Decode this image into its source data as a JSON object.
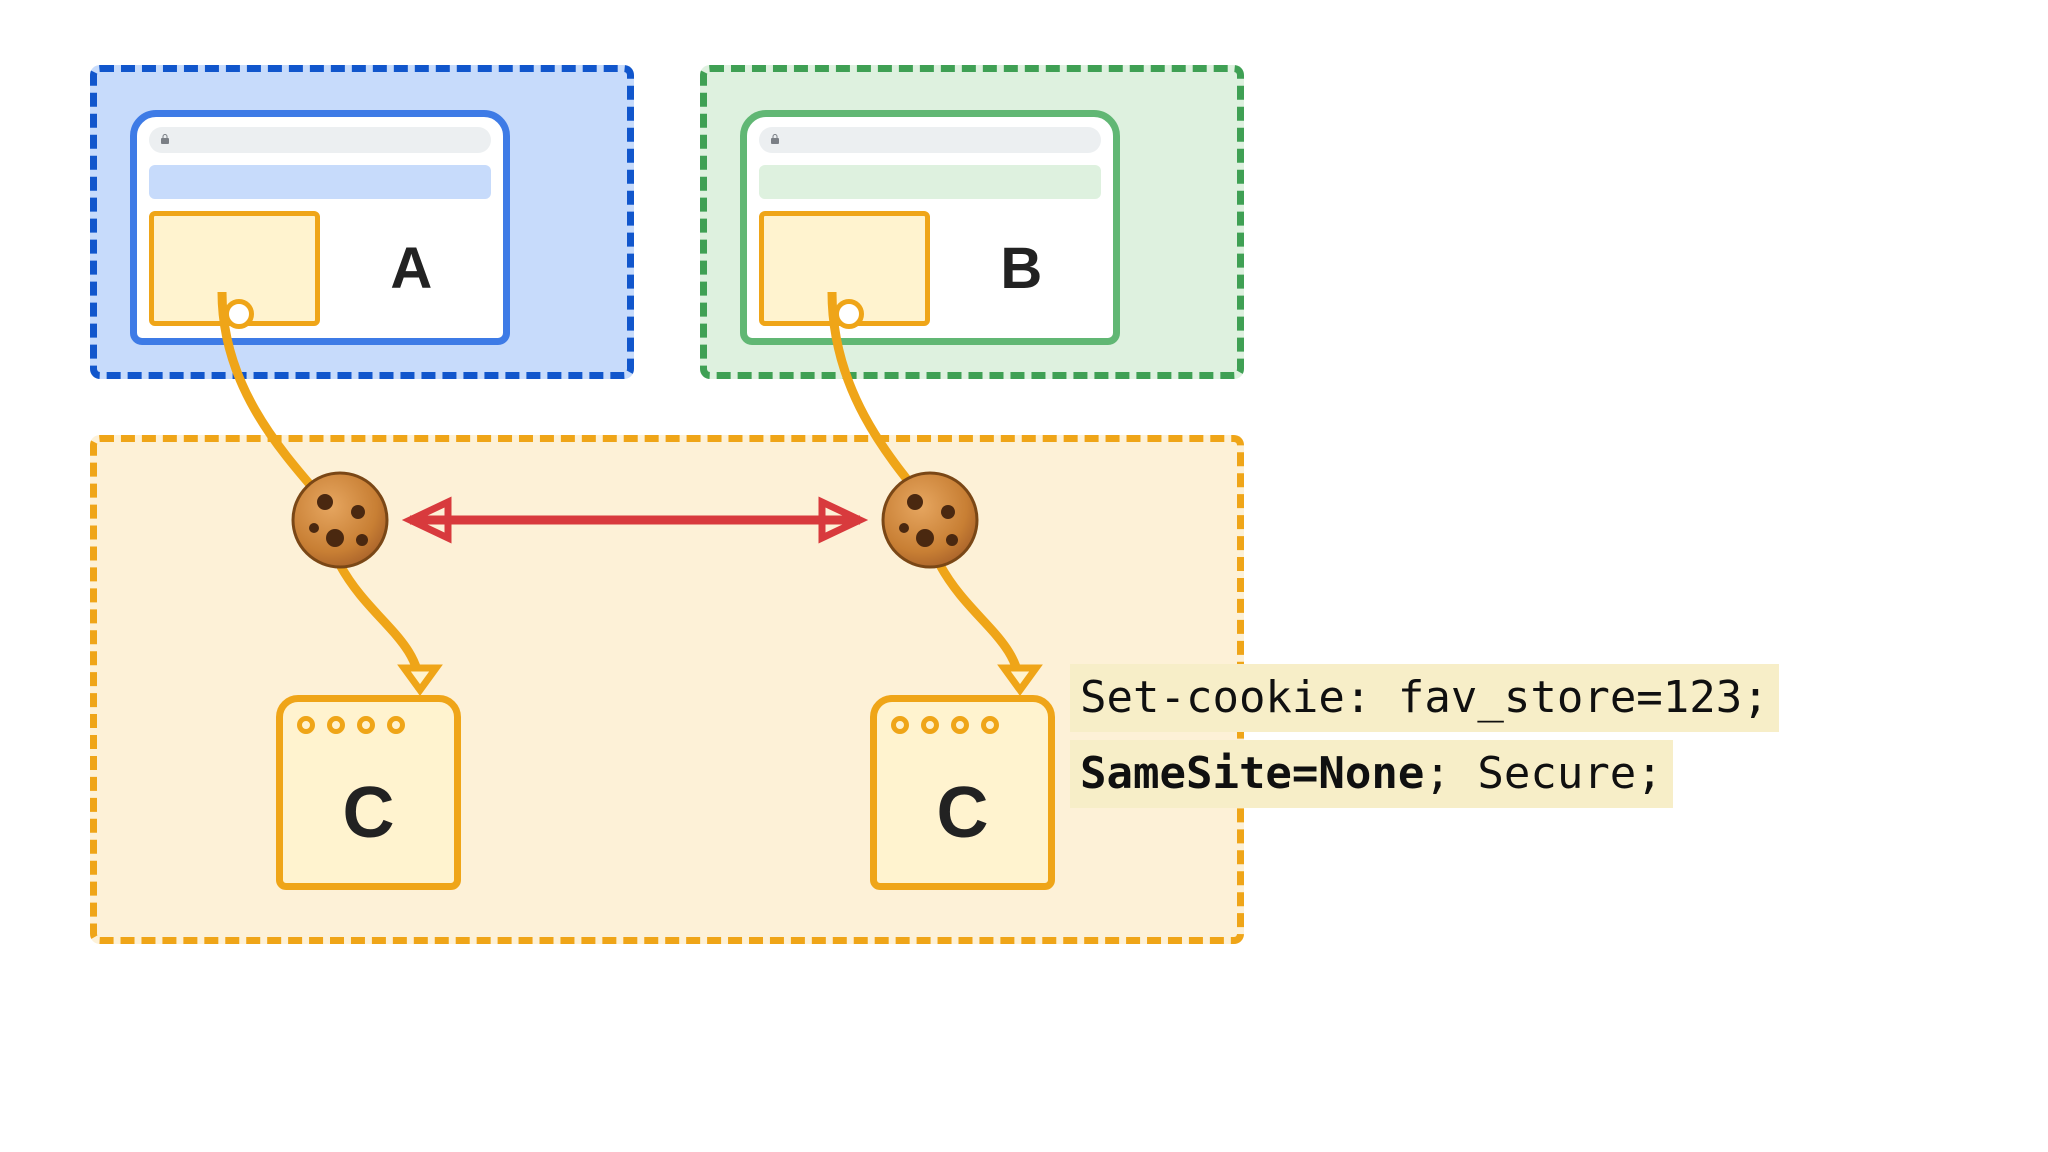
{
  "diagram": {
    "sites": {
      "a": {
        "label": "A"
      },
      "b": {
        "label": "B"
      }
    },
    "shared_context": {
      "app_label": "C"
    },
    "cookie_header": {
      "line1_prefix": "Set-cookie: ",
      "line1_value": "fav_store=123;",
      "line2_attr_bold": "SameSite=None",
      "line2_rest": "; Secure;"
    },
    "colors": {
      "site_a_border": "#1156cc",
      "site_b_border": "#3fa054",
      "third_party": "#efa518",
      "arrow_red": "#d83a3d"
    }
  }
}
